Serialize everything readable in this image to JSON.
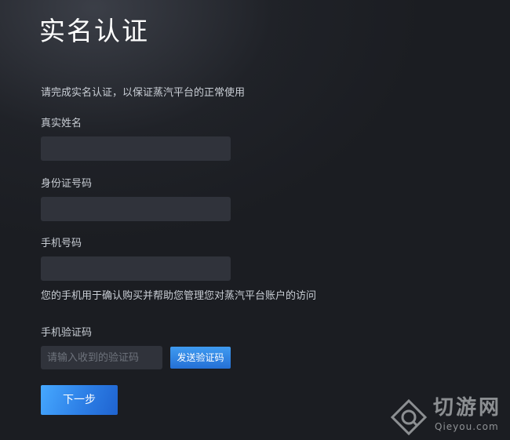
{
  "page": {
    "title": "实名认证",
    "intro": "请完成实名认证，以保证蒸汽平台的正常使用"
  },
  "form": {
    "real_name": {
      "label": "真实姓名",
      "value": "",
      "placeholder": ""
    },
    "id_number": {
      "label": "身份证号码",
      "value": "",
      "placeholder": ""
    },
    "phone": {
      "label": "手机号码",
      "value": "",
      "placeholder": ""
    },
    "phone_note": "您的手机用于确认购买并帮助您管理您对蒸汽平台账户的访问",
    "sms_code": {
      "label": "手机验证码",
      "value": "",
      "placeholder": "请输入收到的验证码"
    },
    "send_code_label": "发送验证码",
    "next_label": "下一步"
  },
  "watermark": {
    "logo_icon": "qieyou-logo-icon",
    "text": "切游网",
    "sub": "Qieyou.com"
  },
  "colors": {
    "background": "#1b1d22",
    "field": "#30333b",
    "accent": "#2d7fe6"
  }
}
